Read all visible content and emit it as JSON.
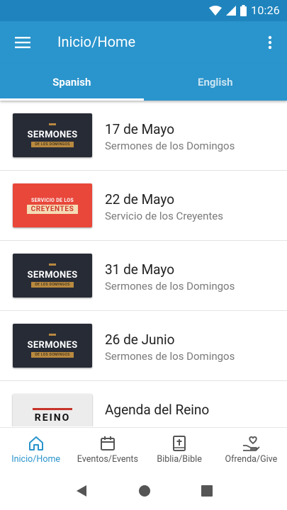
{
  "status_bar": {
    "time": "10:26"
  },
  "app_bar": {
    "title": "Inicio/Home"
  },
  "tabs": [
    {
      "label": "Spanish",
      "active": true
    },
    {
      "label": "English",
      "active": false
    }
  ],
  "items": [
    {
      "title": "17 de Mayo",
      "subtitle": "Sermones de los Domingos",
      "thumb": {
        "text": "SERMONES",
        "ribbon": "DE LOS DOMINGOS"
      }
    },
    {
      "title": "22 de Mayo",
      "subtitle": "Servicio de los Creyentes",
      "thumb": {
        "text": "SERVICIO DE LOS",
        "ribbon": "CREYENTES"
      }
    },
    {
      "title": "31 de Mayo",
      "subtitle": "Sermones de los Domingos",
      "thumb": {
        "text": "SERMONES",
        "ribbon": "DE LOS DOMINGOS"
      }
    },
    {
      "title": "26 de Junio",
      "subtitle": "Sermones de los Domingos",
      "thumb": {
        "text": "SERMONES",
        "ribbon": "DE LOS DOMINGOS"
      }
    },
    {
      "title": "Agenda del Reino",
      "subtitle": "",
      "thumb": {
        "text": "REINO"
      }
    }
  ],
  "bottom_nav": [
    {
      "label": "Inicio/Home",
      "icon": "home-icon",
      "active": true
    },
    {
      "label": "Eventos/Events",
      "icon": "calendar-icon",
      "active": false
    },
    {
      "label": "Biblia/Bible",
      "icon": "bible-icon",
      "active": false
    },
    {
      "label": "Ofrenda/Give",
      "icon": "give-heart-icon",
      "active": false
    }
  ],
  "colors": {
    "primary": "#2a94cc",
    "status_bar": "#1f84bd"
  }
}
